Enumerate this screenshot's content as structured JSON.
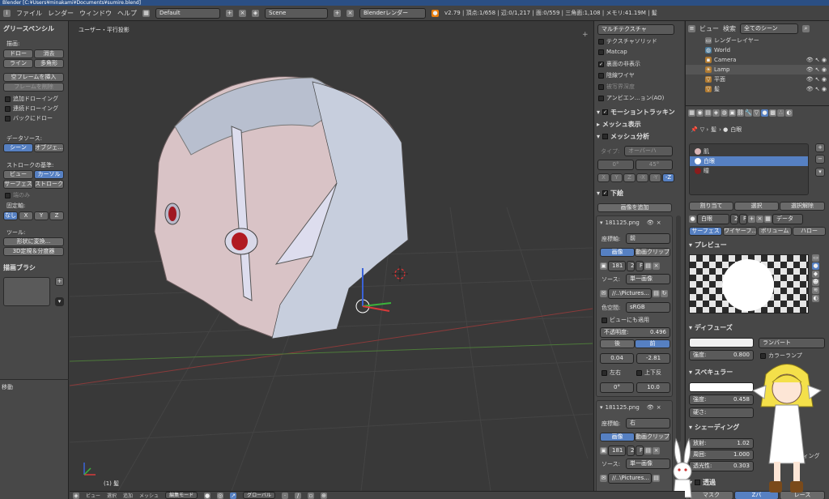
{
  "titlebar": {
    "text": "Blender  [C:¥Users¥minakami¥Documents¥sumire.blend]"
  },
  "infobar": {
    "menus": [
      "ファイル",
      "レンダー",
      "ウィンドウ",
      "ヘルプ"
    ],
    "screen_layout": "Default",
    "scene": "Scene",
    "render_engine": "Blenderレンダー",
    "stats": "v2.79 | 頂点:1/658 | 辺:0/1,217 | 面:0/559 | 三角面:1,108 | メモリ:41.19M | 髪"
  },
  "toolshelf": {
    "gp_title": "グリースペンシル",
    "draw_label": "描画:",
    "draw_btn": "ドロー",
    "erase_btn": "消去",
    "line_btn": "ライン",
    "poly_btn": "多角形",
    "insert_blank": "空フレームを挿入",
    "delete_frame": "フレームを削除",
    "additive": "追加ドローイング",
    "continuous": "連続ドローイング",
    "backdrop": "バックにドロー",
    "datasource_label": "データソース:",
    "scene_btn": "シーン",
    "object_btn": "オブジェ...",
    "stroke_base_label": "ストロークの基準:",
    "view_btn": "ビュー",
    "cursor_btn": "カーソル",
    "surface_btn": "サーフェス",
    "stroke_btn": "ストローク",
    "only_endpoints": "端のみ",
    "lock_axis_label": "固定軸:",
    "axis_none": "なし",
    "axis_x": "X",
    "axis_y": "Y",
    "axis_z": "Z",
    "tools_label": "ツール:",
    "convert_btn": "形状に変換...",
    "reproject_btn": "3D定規＆分度器",
    "brush_title": "描画ブラシ",
    "move_label": "移動"
  },
  "viewport": {
    "view_label": "ユーザー・平行投影",
    "object_label": "(1) 髪"
  },
  "npanel": {
    "shading_mode": "マルチテクスチャ",
    "texture_solid": "テクスチャソリッド",
    "matcap": "Matcap",
    "backface_hide": "裏面の非表示",
    "wireframe": "陰線ワイヤ",
    "dof": "被写界深度",
    "ao": "アンビエン…ョン(AO)",
    "motion_tracking": "モーショントラッキン",
    "mesh_display": "メッシュ表示",
    "mesh_analysis": "メッシュ分析",
    "type_label": "タイプ:",
    "type_value": "オーバーハ",
    "angle_min": "0°",
    "angle_max": "45°",
    "axes": [
      "X",
      "Y",
      "Z",
      "-X",
      "-Y",
      "-Z"
    ],
    "background_images": "下絵",
    "add_image": "画像を追加",
    "bg1": {
      "name": "181125.png",
      "axis_label": "座標軸:",
      "axis_value": "前",
      "image_tab": "画像",
      "movie_tab": "動画クリップ",
      "users": "181",
      "users2": "2",
      "fake": "F",
      "source_label": "ソース:",
      "source_value": "単一画像",
      "path": "//..\\Pictures...",
      "colorspace_label": "色空間:",
      "colorspace_value": "sRGB",
      "view_as_render": "ビューにも適用",
      "opacity_label": "不透明度:",
      "opacity_value": "0.496",
      "back": "後",
      "front": "前",
      "x_off": "0.04",
      "y_off": "-2.81",
      "flip_x": "左右",
      "flip_y": "上下反",
      "rotation": "0°",
      "size": "10.0"
    },
    "bg2": {
      "name": "181125.png",
      "axis_label": "座標軸:",
      "axis_value": "右",
      "image_tab": "画像",
      "movie_tab": "動画クリップ",
      "users": "181",
      "users2": "2",
      "fake": "F",
      "source_label": "ソース:",
      "source_value": "単一画像",
      "path": "//..\\Pictures..."
    }
  },
  "outliner": {
    "view_menu": "ビュー",
    "search_menu": "検索",
    "filter": "全てのシーン",
    "items": [
      "レンダーレイヤー",
      "World",
      "Camera",
      "Lamp",
      "平面",
      "髪"
    ]
  },
  "properties": {
    "breadcrumb_obj": "髪",
    "breadcrumb_mat": "白眼",
    "materials": [
      "肌",
      "白眼",
      "瞳"
    ],
    "assign": "割り当て",
    "select": "選択",
    "deselect": "選択解除",
    "mat_name": "白眼",
    "mat_users": "2",
    "mat_fake": "F",
    "data_label": "データ",
    "tabs": [
      "サーフェス",
      "ワイヤーフ...",
      "ボリューム",
      "ハロー"
    ],
    "preview": "プレビュー",
    "diffuse": "ディフューズ",
    "diffuse_shader": "ランバート",
    "intensity_label": "強度:",
    "diffuse_intensity": "0.800",
    "color_ramp": "カラーランプ",
    "specular": "スペキュラー",
    "specular_intensity": "0.458",
    "hardness_label": "硬さ:",
    "shading": "シェーディング",
    "emit_label": "放射:",
    "emit_value": "1.02",
    "ambient_label": "周囲:",
    "ambient_value": "1.000",
    "translucency_label": "透光性:",
    "translucency_value": "0.303",
    "tangent_shading": "ディング",
    "transparency": "透過",
    "mask_btn": "マスク",
    "zbuffer_btn": "Zバ",
    "raytrace_btn": "レース"
  },
  "footer": {
    "items": [
      "ビュー",
      "選択",
      "追加",
      "メッシュ",
      "編集モード",
      "グローバル"
    ]
  },
  "colors": {
    "accent": "#5680c2",
    "header": "#434343",
    "panel": "#474747",
    "viewport": "#393939"
  }
}
